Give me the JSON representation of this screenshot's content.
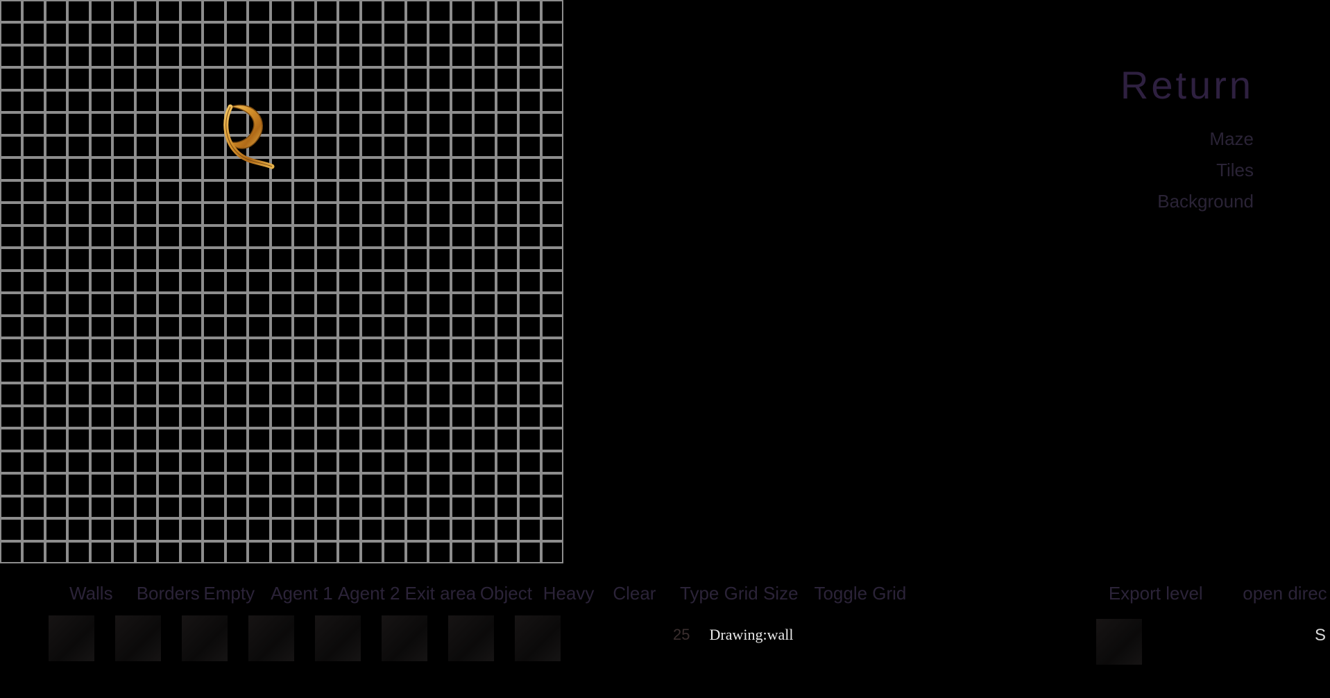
{
  "grid": {
    "cols": 25,
    "rows": 25,
    "size_value": "25"
  },
  "side_menu": {
    "title": "Return",
    "items": [
      "Maze",
      "Tiles",
      "Background"
    ]
  },
  "toolbar": {
    "walls": "Walls",
    "borders": "Borders",
    "empty": "Empty",
    "agent1": "Agent 1",
    "agent2": "Agent 2",
    "exit_area": "Exit area",
    "object": "Object",
    "heavy": "Heavy",
    "clear": "Clear",
    "type_grid_size": "Type Grid Size",
    "toggle_grid": "Toggle Grid",
    "export_level": "Export level",
    "open_dir": "open direc"
  },
  "status": {
    "drawing": "Drawing:wall",
    "trailing": "S"
  }
}
